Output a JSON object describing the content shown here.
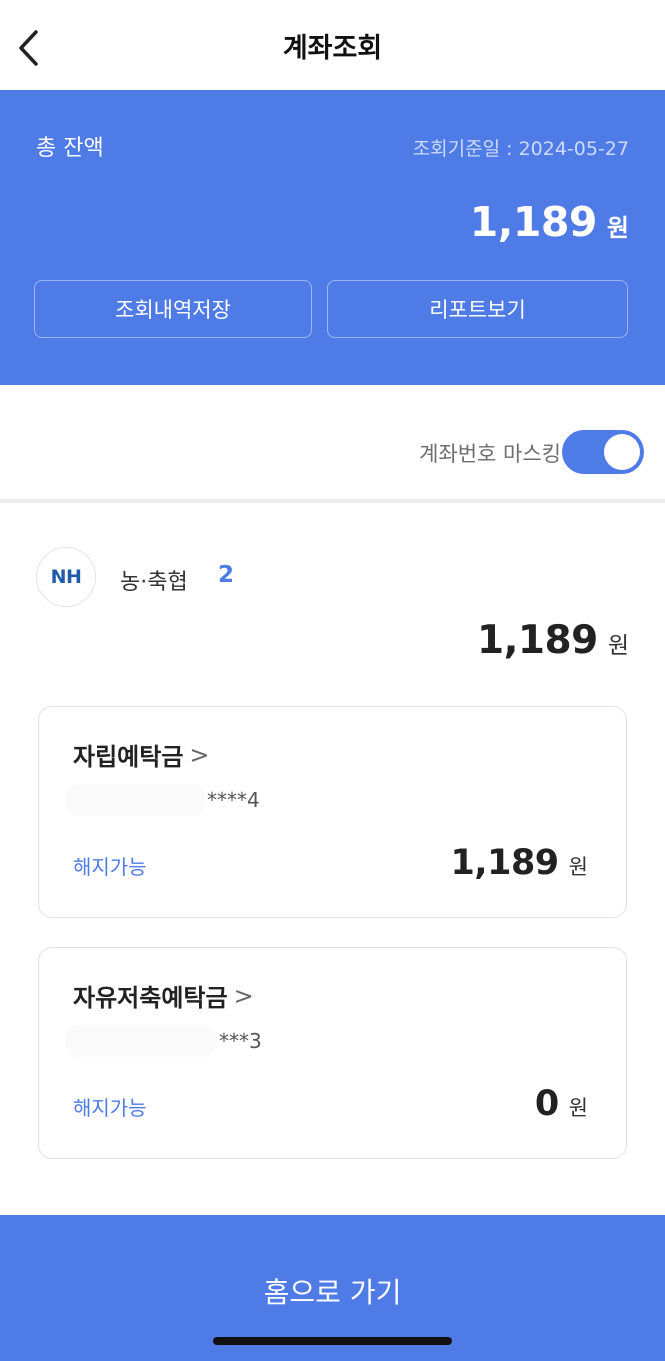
{
  "header": {
    "title": "계좌조회",
    "back_icon": "chevron-left-icon"
  },
  "hero": {
    "label": "총 잔액",
    "date": "조회기준일 : 2024-05-27",
    "amount": "1,189",
    "unit": "원",
    "save_button": "조회내역저장",
    "report_button": "리포트보기",
    "background_color": "#4e7be6"
  },
  "masking": {
    "label": "계좌번호 마스킹",
    "enabled": true
  },
  "bank": {
    "logo_text": "NH",
    "name": "농·축협",
    "count": "2",
    "total": "1,189",
    "unit": "원"
  },
  "accounts": [
    {
      "title": "자립예탁금",
      "chevron": ">",
      "number_tail": "****4",
      "status": "해지가능",
      "amount": "1,189",
      "unit": "원"
    },
    {
      "title": "자유저축예탁금",
      "chevron": ">",
      "number_tail": "***3",
      "status": "해지가능",
      "amount": "0",
      "unit": "원"
    }
  ],
  "footer": {
    "home_button": "홈으로 가기"
  }
}
